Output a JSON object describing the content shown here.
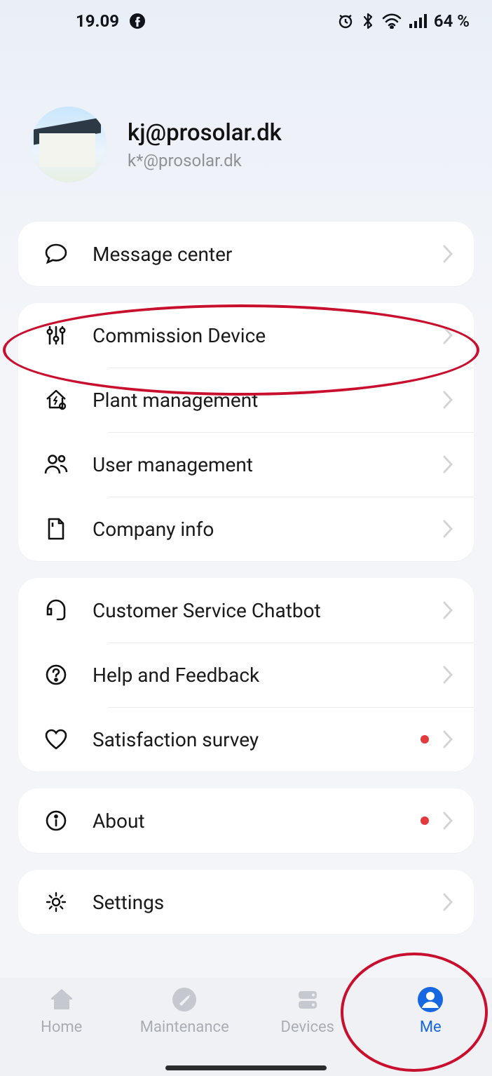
{
  "statusbar": {
    "time": "19.09",
    "battery_text": "64 %"
  },
  "profile": {
    "display_name": "kj@prosolar.dk",
    "sub_name": "k*@prosolar.dk"
  },
  "groups": [
    {
      "rows": [
        {
          "key": "message-center",
          "icon": "message",
          "label": "Message center",
          "dot": false
        }
      ]
    },
    {
      "rows": [
        {
          "key": "commission-device",
          "icon": "sliders",
          "label": "Commission Device",
          "dot": false
        },
        {
          "key": "plant-management",
          "icon": "house-bolt",
          "label": "Plant management",
          "dot": false
        },
        {
          "key": "user-management",
          "icon": "users",
          "label": "User management",
          "dot": false
        },
        {
          "key": "company-info",
          "icon": "doc",
          "label": "Company info",
          "dot": false
        }
      ]
    },
    {
      "rows": [
        {
          "key": "customer-service",
          "icon": "headset",
          "label": "Customer Service Chatbot",
          "dot": false
        },
        {
          "key": "help-feedback",
          "icon": "question",
          "label": "Help and Feedback",
          "dot": false
        },
        {
          "key": "satisfaction-survey",
          "icon": "heart",
          "label": "Satisfaction survey",
          "dot": true
        }
      ]
    },
    {
      "rows": [
        {
          "key": "about",
          "icon": "info",
          "label": "About",
          "dot": true
        }
      ]
    },
    {
      "rows": [
        {
          "key": "settings",
          "icon": "gear",
          "label": "Settings",
          "dot": false
        }
      ]
    }
  ],
  "tabs": [
    {
      "key": "home",
      "icon": "home",
      "label": "Home",
      "active": false
    },
    {
      "key": "maintenance",
      "icon": "wrench",
      "label": "Maintenance",
      "active": false
    },
    {
      "key": "devices",
      "icon": "devices",
      "label": "Devices",
      "active": false
    },
    {
      "key": "me",
      "icon": "person",
      "label": "Me",
      "active": true
    }
  ]
}
